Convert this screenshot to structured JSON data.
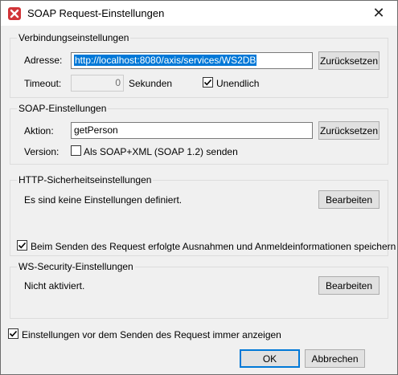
{
  "window": {
    "title": "SOAP Request-Einstellungen",
    "close_glyph": "✕",
    "icon": "altova-x-icon",
    "accent": "#d13438"
  },
  "connection": {
    "title": "Verbindungseinstellungen",
    "address_label": "Adresse:",
    "address_value": "http://localhost:8080/axis/services/WS2DB",
    "reset_label": "Zurücksetzen",
    "timeout_label": "Timeout:",
    "timeout_value": "0",
    "seconds_label": "Sekunden",
    "infinite_label": "Unendlich",
    "infinite_checked": true
  },
  "soap": {
    "title": "SOAP-Einstellungen",
    "action_label": "Aktion:",
    "action_value": "getPerson",
    "reset_label": "Zurücksetzen",
    "version_label": "Version:",
    "soap12_label": "Als SOAP+XML (SOAP 1.2) senden",
    "soap12_checked": false
  },
  "http": {
    "title": "HTTP-Sicherheitseinstellungen",
    "status_text": "Es sind keine Einstellungen definiert.",
    "edit_label": "Bearbeiten",
    "save_label": "Beim Senden des Request erfolgte Ausnahmen und Anmeldeinformationen speichern",
    "save_checked": true
  },
  "wssecurity": {
    "title": "WS-Security-Einstellungen",
    "status_text": "Nicht aktiviert.",
    "edit_label": "Bearbeiten"
  },
  "footer": {
    "always_show_label": "Einstellungen vor dem Senden des Request immer anzeigen",
    "always_show_checked": true,
    "ok_label": "OK",
    "cancel_label": "Abbrechen"
  }
}
